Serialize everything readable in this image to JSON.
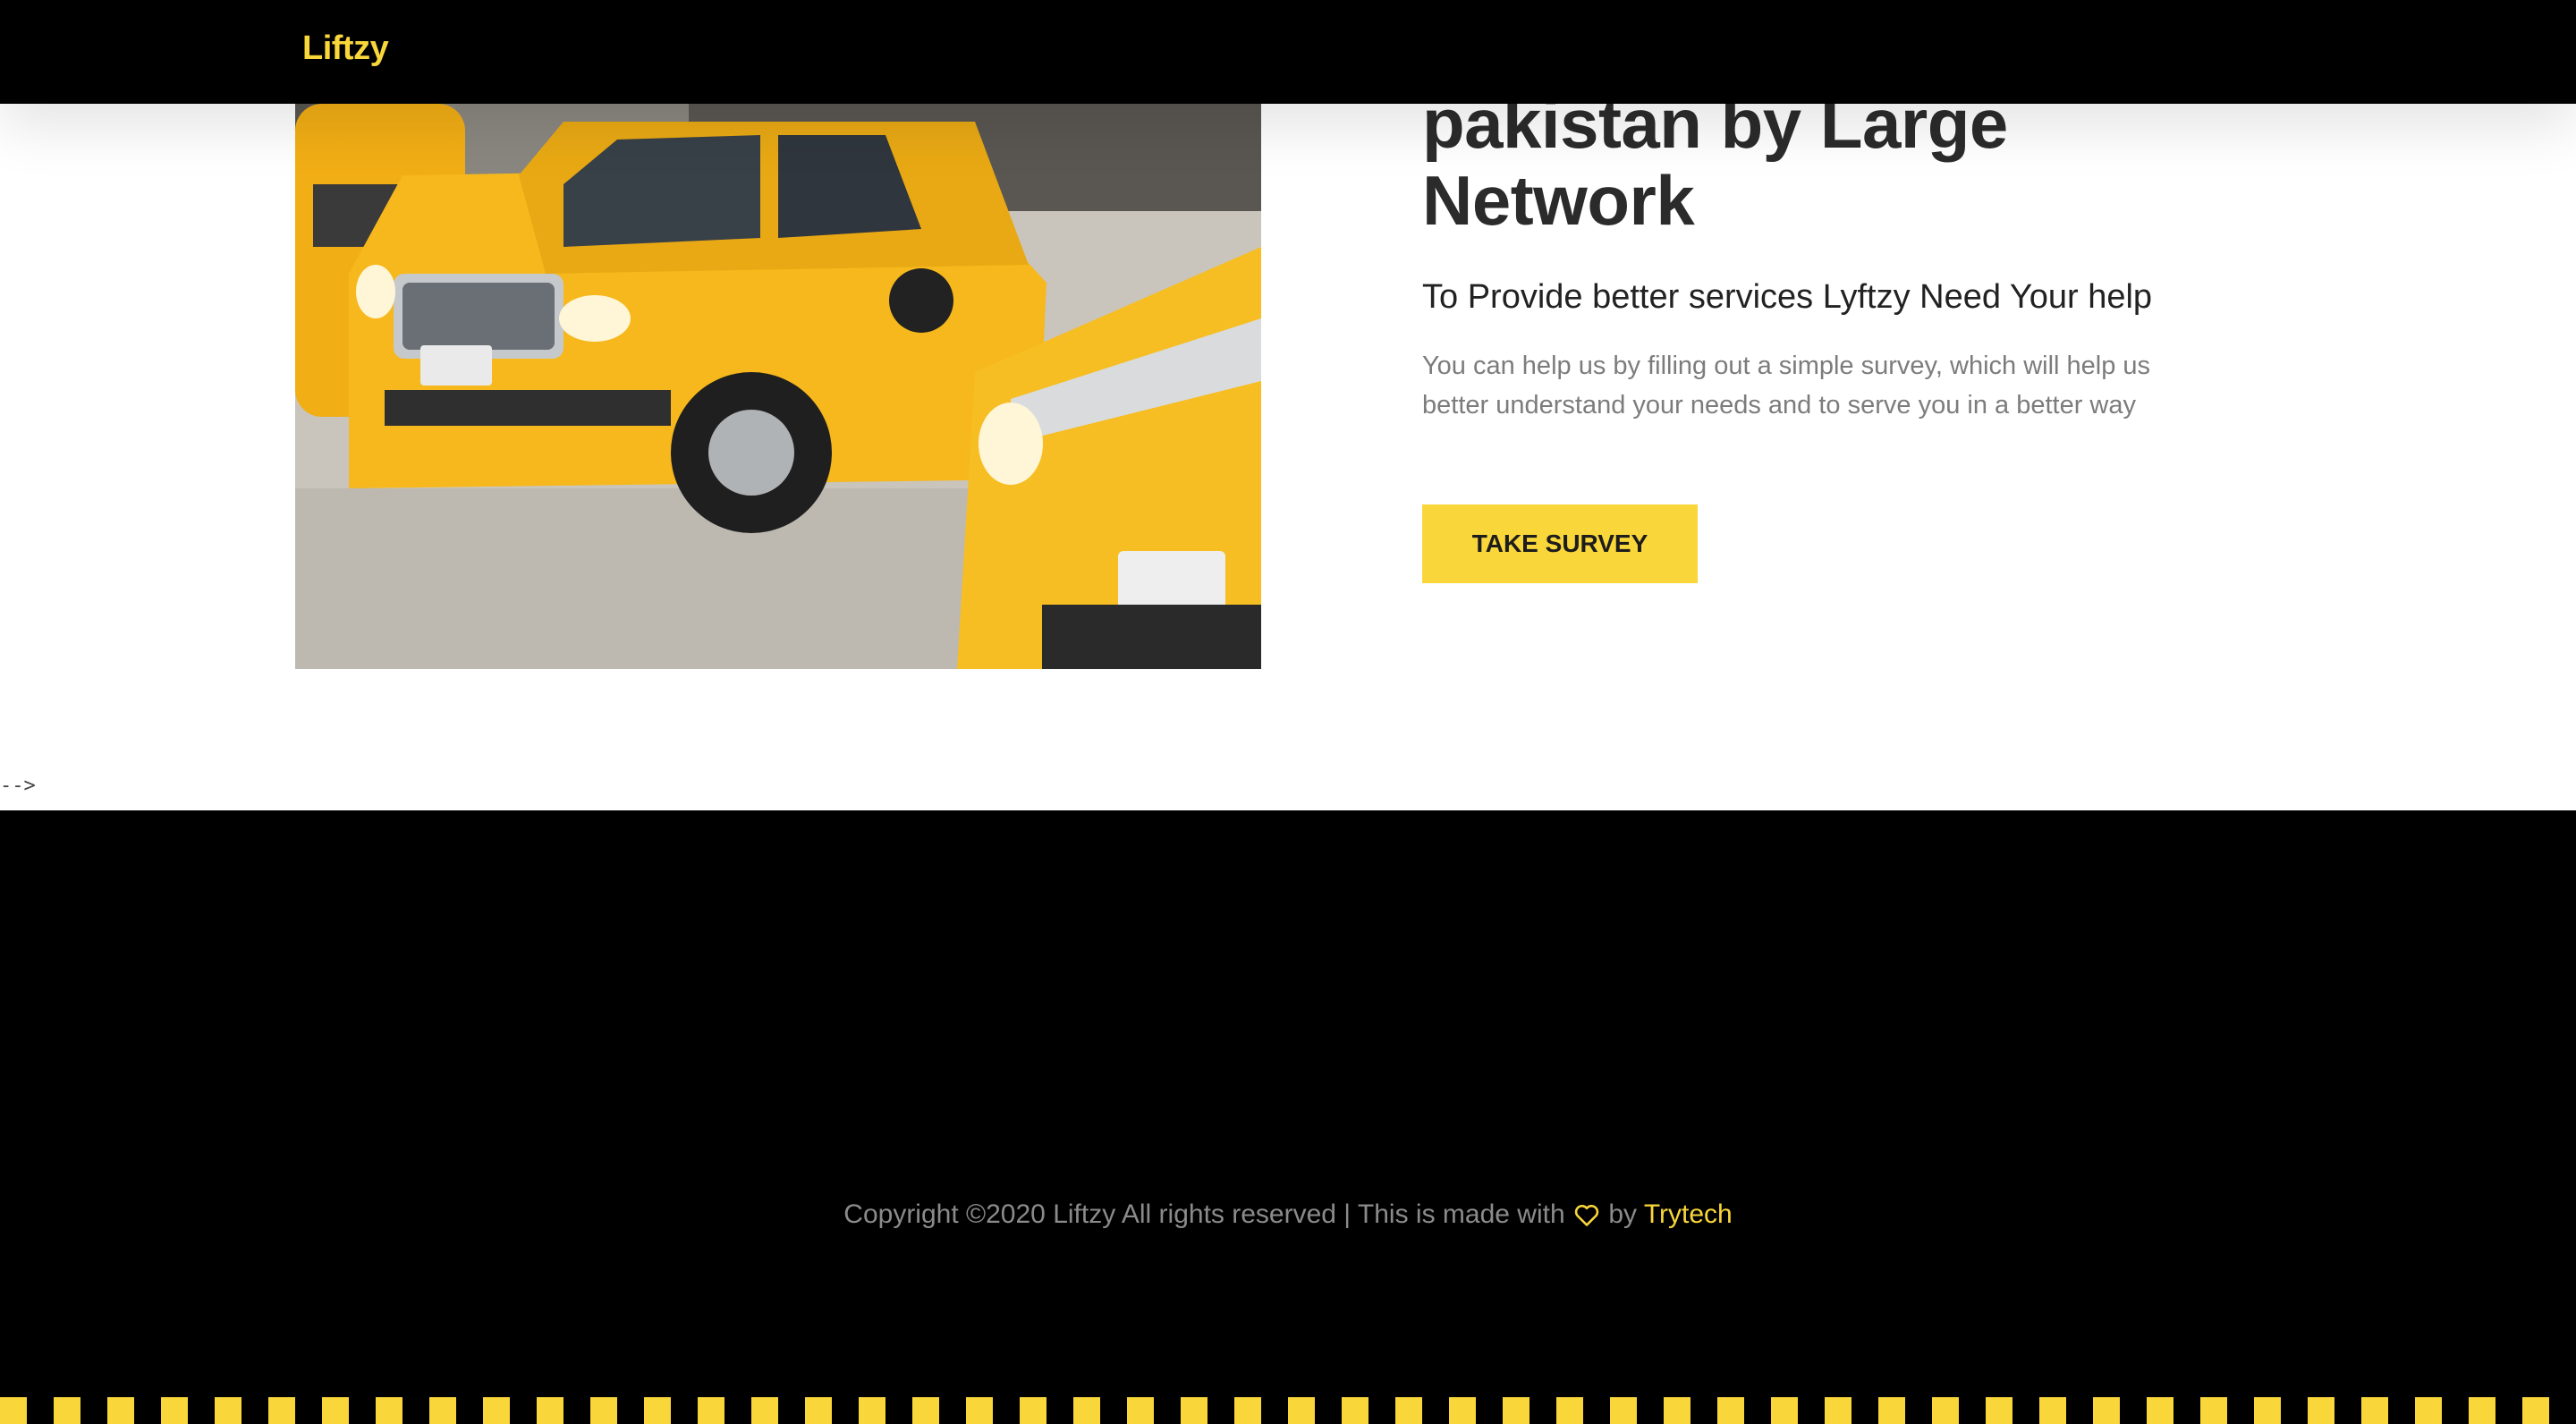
{
  "navbar": {
    "brand": "Liftzy"
  },
  "hero": {
    "image_alt": "Yellow taxi cabs on a city street",
    "headline_line1": "pakistan by Large",
    "headline_line2": "Network",
    "subheading": "To Provide better services Lyftzy Need Your help",
    "description": "You can help us by filling out a simple survey, which will help us better understand your needs and to serve you in a better way",
    "cta_label": "TAKE SURVEY"
  },
  "stray_text": "-->",
  "footer": {
    "copyright_prefix": "Copyright ©2020 Liftzy All rights reserved | This is made with",
    "heart_icon": "heart-icon",
    "by_text": "by",
    "credit_link": "Trytech"
  },
  "colors": {
    "accent": "#f9d63a",
    "dark": "#000000",
    "muted": "#8b8b8b"
  }
}
